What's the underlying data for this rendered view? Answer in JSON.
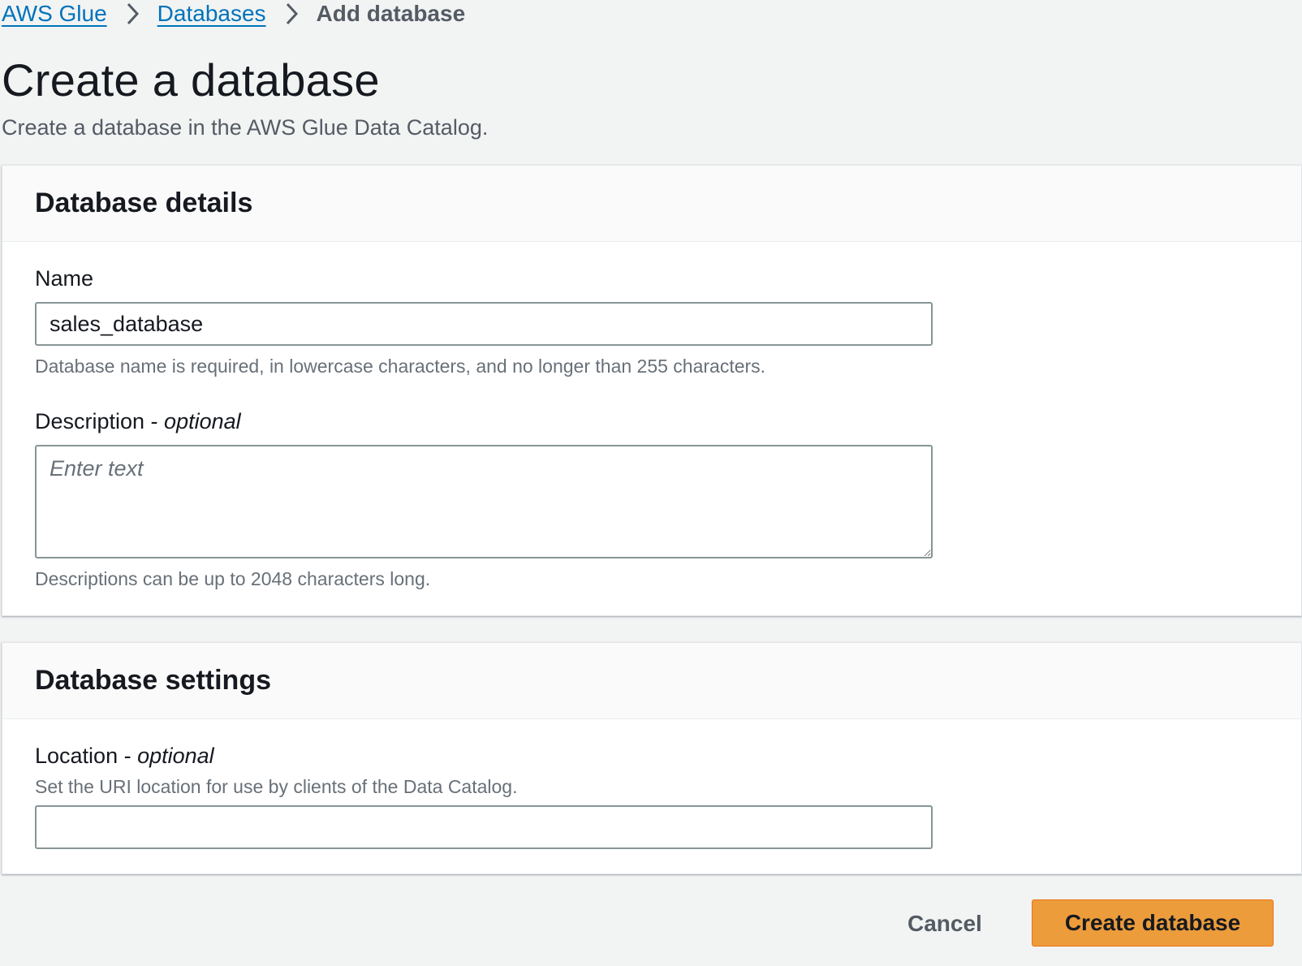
{
  "breadcrumb": {
    "items": [
      {
        "label": "AWS Glue"
      },
      {
        "label": "Databases"
      },
      {
        "label": "Add database"
      }
    ]
  },
  "page": {
    "title": "Create a database",
    "subtitle": "Create a database in the AWS Glue Data Catalog."
  },
  "details_panel": {
    "heading": "Database details",
    "name_label": "Name",
    "name_value": "sales_database",
    "name_hint": "Database name is required, in lowercase characters, and no longer than 255 characters.",
    "description_label": "Description - ",
    "description_optional": "optional",
    "description_placeholder": "Enter text",
    "description_hint": "Descriptions can be up to 2048 characters long."
  },
  "settings_panel": {
    "heading": "Database settings",
    "location_label": "Location - ",
    "location_optional": "optional",
    "location_hint": "Set the URI location for use by clients of the Data Catalog.",
    "location_value": ""
  },
  "footer": {
    "cancel_label": "Cancel",
    "create_label": "Create database"
  },
  "icons": {
    "breadcrumb_separator": "chevron-right-icon",
    "resize_handle": "resize-handle-icon"
  },
  "colors": {
    "link": "#0073bb",
    "primary_button": "#ec9c3b",
    "page_background": "#f2f3f3"
  }
}
